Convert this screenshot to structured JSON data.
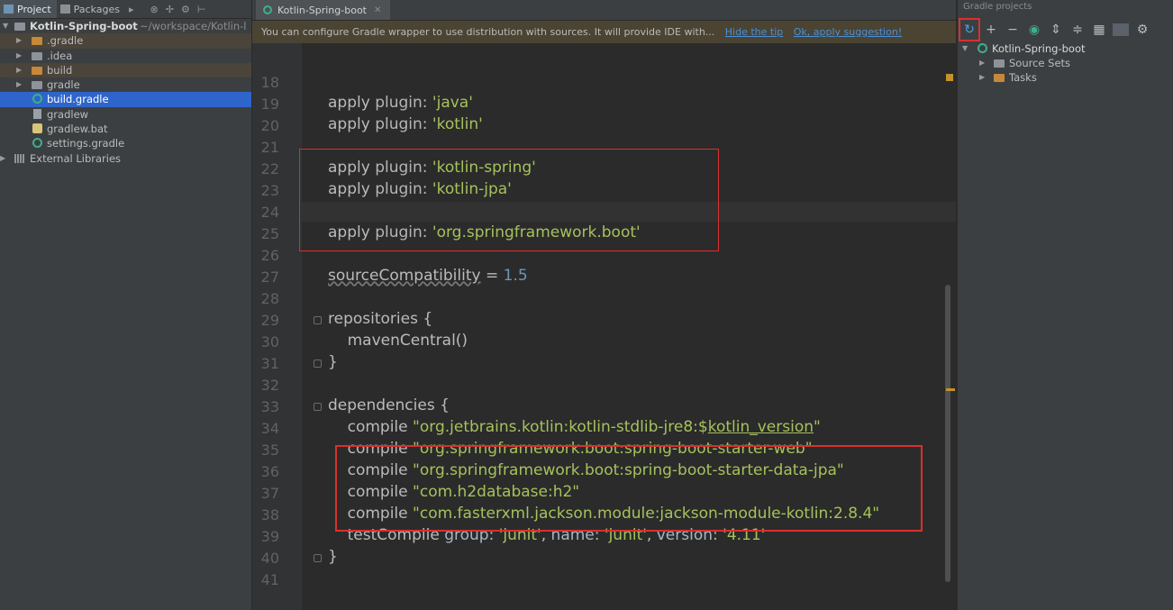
{
  "project_panel": {
    "tabs": [
      {
        "label": "Project"
      },
      {
        "label": "Packages"
      }
    ],
    "tree": [
      {
        "label": "Kotlin-Spring-boot",
        "path_hint": "~/workspace/Kotlin-l"
      },
      {
        "label": ".gradle"
      },
      {
        "label": ".idea"
      },
      {
        "label": "build"
      },
      {
        "label": "gradle"
      },
      {
        "label": "build.gradle"
      },
      {
        "label": "gradlew"
      },
      {
        "label": "gradlew.bat"
      },
      {
        "label": "settings.gradle"
      },
      {
        "label": "External Libraries"
      }
    ]
  },
  "editor": {
    "tab": {
      "label": "Kotlin-Spring-boot"
    },
    "banner": {
      "text": "You can configure Gradle wrapper to use distribution with sources. It will provide IDE with...",
      "hide_tip": "Hide the tip",
      "apply": "Ok, apply suggestion!"
    },
    "line_numbers": [
      "18",
      "19",
      "20",
      "21",
      "22",
      "23",
      "24",
      "25",
      "26",
      "27",
      "28",
      "29",
      "30",
      "31",
      "32",
      "33",
      "34",
      "35",
      "36",
      "37",
      "38",
      "39",
      "40",
      "41"
    ],
    "code": {
      "l19a": "apply",
      "l19b": "plugin",
      "l19c": ": ",
      "l19d": "'java'",
      "l20a": "apply",
      "l20b": "plugin",
      "l20c": ": ",
      "l20d": "'kotlin'",
      "l22a": "apply",
      "l22b": "plugin",
      "l22c": ": ",
      "l22d": "'kotlin-spring'",
      "l23a": "apply",
      "l23b": "plugin",
      "l23c": ": ",
      "l23d": "'kotlin-jpa'",
      "l25a": "apply",
      "l25b": "plugin",
      "l25c": ": ",
      "l25d": "'org.springframework.boot'",
      "l27a": "sourceCompatibility",
      "l27b": " = ",
      "l27c": "1.5",
      "l29": "repositories {",
      "l30": "    mavenCentral()",
      "l31": "}",
      "l33": "dependencies {",
      "l34a": "    compile ",
      "l34b": "\"org.jetbrains.kotlin:kotlin-stdlib-jre8:$",
      "l34c": "kotlin_version",
      "l34d": "\"",
      "l35a": "    compile ",
      "l35b": "\"org.springframework.boot:spring-boot-starter-web\"",
      "l36a": "    compile ",
      "l36b": "\"org.springframework.boot:spring-boot-starter-data-jpa\"",
      "l37a": "    compile ",
      "l37b": "\"com.h2database:h2\"",
      "l38a": "    compile ",
      "l38b": "\"com.fasterxml.jackson.module:jackson-module-kotlin:2.8.4\"",
      "l39a": "    testCompile ",
      "l39b": "group",
      "l39c": ": ",
      "l39d": "'junit'",
      "l39e": ", ",
      "l39f": "name",
      "l39g": ": ",
      "l39h": "'junit'",
      "l39i": ", ",
      "l39j": "version",
      "l39k": ": ",
      "l39l": "'4.11'",
      "l40": "}"
    }
  },
  "gradle_panel": {
    "title": "Gradle projects",
    "tree": [
      {
        "label": "Kotlin-Spring-boot"
      },
      {
        "label": "Source Sets"
      },
      {
        "label": "Tasks"
      }
    ],
    "toolbar_icons": [
      "refresh-icon",
      "plus-icon",
      "minus-icon",
      "gradle-icon",
      "expand-all-icon",
      "collapse-all-icon",
      "offline-icon",
      "toggle-icon",
      "settings-icon"
    ]
  },
  "colors": {
    "accent_selection": "#2f65ca",
    "highlight_box": "#d9302e",
    "string": "#a5c25c",
    "number": "#6897bb"
  }
}
